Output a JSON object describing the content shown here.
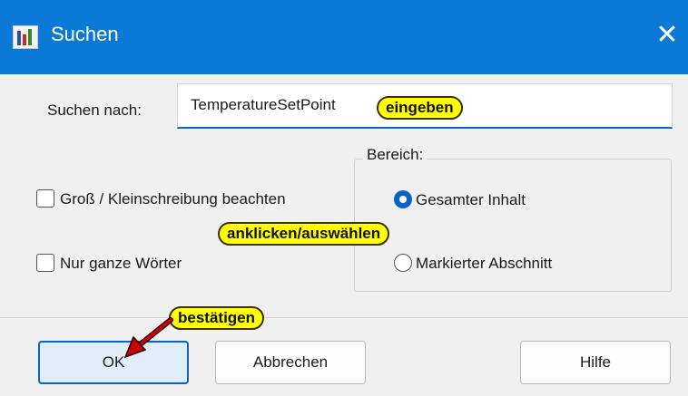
{
  "window": {
    "title": "Suchen",
    "close_glyph": "✕",
    "icon": "app-icon",
    "accent_color": "#0a7ad6"
  },
  "search": {
    "label": "Suchen nach:",
    "value": "TemperatureSetPoint"
  },
  "options": {
    "match_case": {
      "label": "Groß / Kleinschreibung beachten",
      "checked": false
    },
    "whole_words": {
      "label": "Nur ganze Wörter",
      "checked": false
    }
  },
  "scope": {
    "title": "Bereich:",
    "options": [
      {
        "label": "Gesamter Inhalt",
        "selected": true
      },
      {
        "label": "Markierter Abschnitt",
        "selected": false
      }
    ]
  },
  "annotations": {
    "input_hint": "eingeben",
    "select_hint": "anklicken/auswählen",
    "confirm_hint": "bestätigen",
    "callout_color": "#ffff00",
    "arrow_color": "#cc0000"
  },
  "buttons": {
    "ok": "OK",
    "cancel": "Abbrechen",
    "help": "Hilfe"
  }
}
